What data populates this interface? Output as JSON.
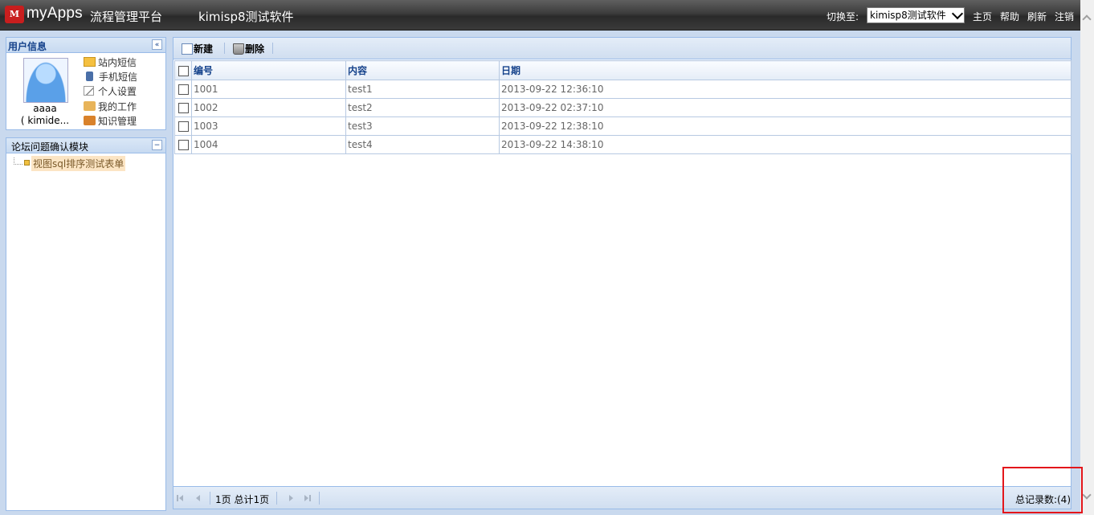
{
  "header": {
    "logo_mark": "M",
    "logo_text": "myApps",
    "logo_subtitle": "流程管理平台",
    "app_name": "kimisp8测试软件",
    "switch_label": "切换至:",
    "switch_value": "kimisp8测试软件",
    "links": [
      "主页",
      "帮助",
      "刷新",
      "注销"
    ]
  },
  "user_panel": {
    "title": "用户信息",
    "collapse_glyph": "«",
    "name": "aaaa",
    "org": "( kimide...",
    "links": [
      "站内短信",
      "手机短信",
      "个人设置",
      "我的工作",
      "知识管理"
    ]
  },
  "module_panel": {
    "title": "论坛问题确认模块",
    "collapse_glyph": "−",
    "items": [
      "视图sql排序测试表单"
    ]
  },
  "toolbar": {
    "new_label": "新建",
    "delete_label": "删除"
  },
  "grid": {
    "columns": [
      "编号",
      "内容",
      "日期"
    ],
    "rows": [
      [
        "1001",
        "test1",
        "2013-09-22 12:36:10"
      ],
      [
        "1002",
        "test2",
        "2013-09-22 02:37:10"
      ],
      [
        "1003",
        "test3",
        "2013-09-22 12:38:10"
      ],
      [
        "1004",
        "test4",
        "2013-09-22 14:38:10"
      ]
    ]
  },
  "pager": {
    "page_info": "1页 总计1页",
    "total": "总记录数:(4)"
  },
  "colors": {
    "accent": "#15428b",
    "panel_border": "#99bbe8",
    "highlight": "#e3161b"
  }
}
